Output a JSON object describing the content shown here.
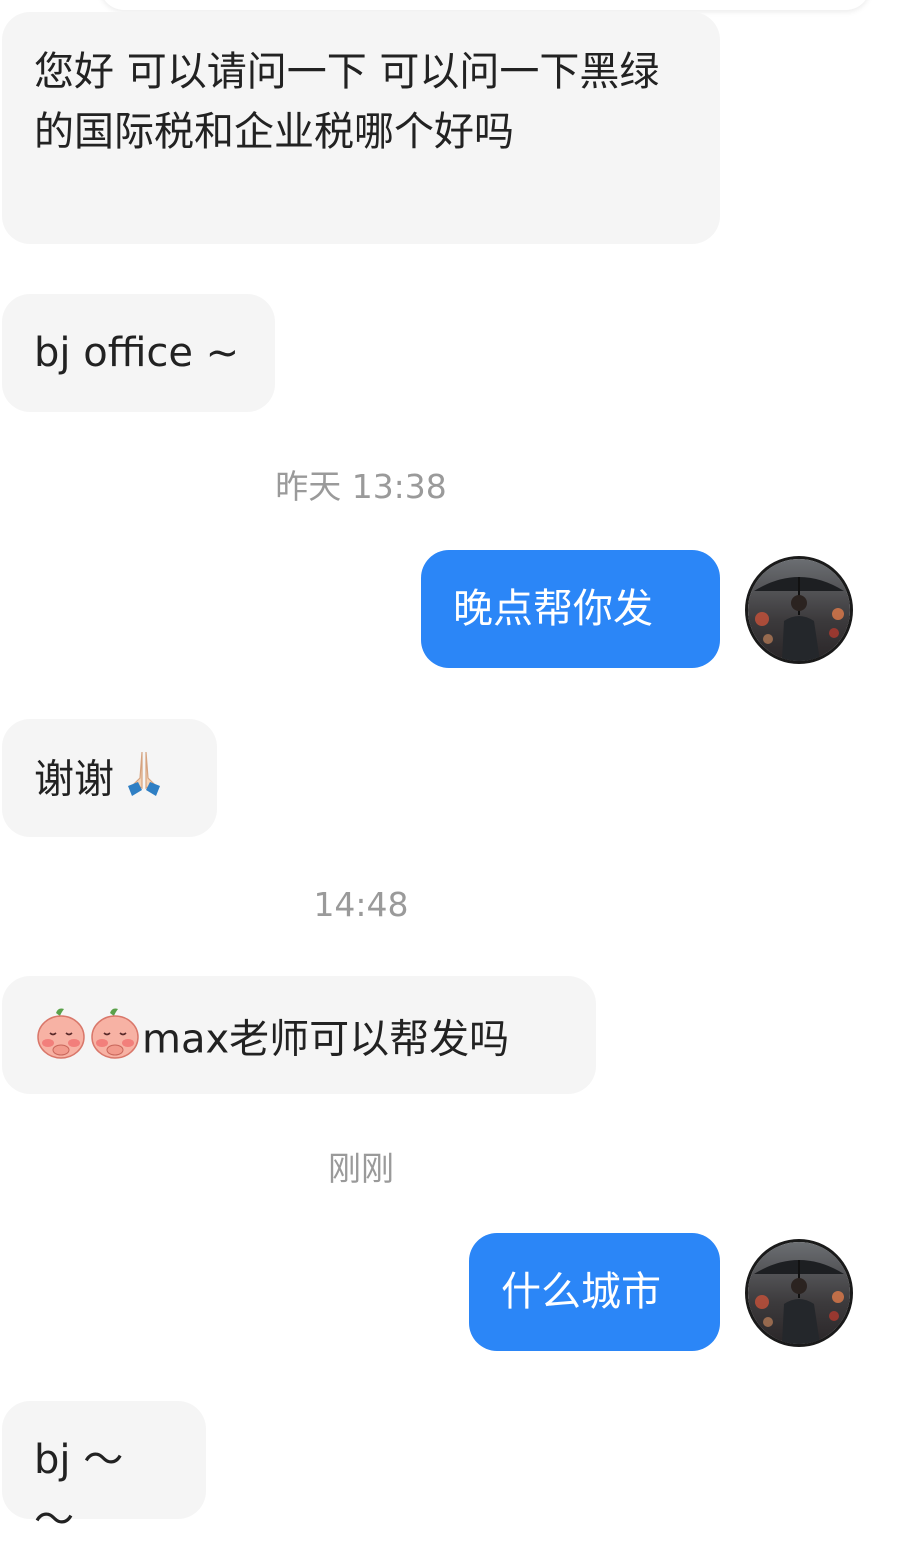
{
  "messages": [
    {
      "text": "您好 可以请问一下 可以问一下黑绿的国际税和企业税哪个好吗"
    },
    {
      "text": "bj office ~"
    },
    {
      "timestamp": "昨天 13:38"
    },
    {
      "text": "晚点帮你发"
    },
    {
      "text": "谢谢",
      "emoji": "folded-hands"
    },
    {
      "timestamp": "14:48"
    },
    {
      "text": "max老师可以帮发吗",
      "stickers": [
        "peach-sticker",
        "peach-sticker"
      ]
    },
    {
      "timestamp": "刚刚"
    },
    {
      "text": "什么城市"
    },
    {
      "text": "bj ～ ～"
    }
  ],
  "colors": {
    "sent_bubble": "#2b86f7",
    "received_bubble": "#f5f5f5",
    "timestamp": "#9a9a9a"
  }
}
